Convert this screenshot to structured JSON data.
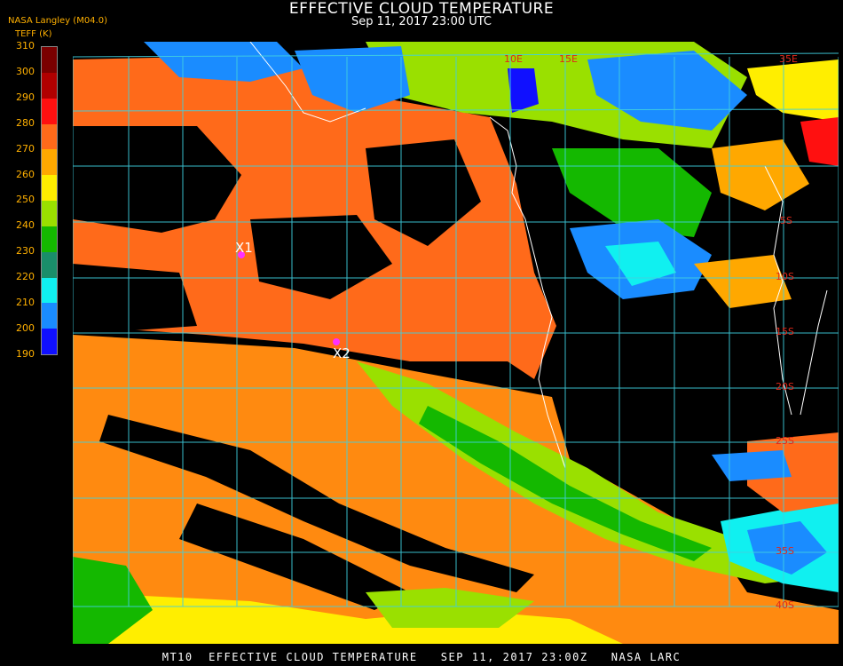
{
  "header": {
    "title": "EFFECTIVE CLOUD TEMPERATURE",
    "subtitle": "Sep 11, 2017 23:00 UTC",
    "source": "NASA Langley (M04.0)",
    "units": "TEFF (K)"
  },
  "colorbar": {
    "labels": [
      "310",
      "300",
      "290",
      "280",
      "270",
      "260",
      "250",
      "240",
      "230",
      "220",
      "210",
      "200",
      "190"
    ],
    "colors": [
      "#7a0000",
      "#b00000",
      "#ff1010",
      "#ff6a1a",
      "#ffa800",
      "#ffee00",
      "#9ae000",
      "#14b800",
      "#1a8e6a",
      "#10f0f0",
      "#1a8cff",
      "#1010ff",
      "#9030e0"
    ]
  },
  "map": {
    "longitude_labels": [
      "10E",
      "15E",
      "35E"
    ],
    "latitude_labels": [
      "5S",
      "10S",
      "15S",
      "20S",
      "25S",
      "35S",
      "40S"
    ],
    "markers": [
      {
        "label": "X1",
        "color": "#ff30ff"
      },
      {
        "label": "X2",
        "color": "#ff30ff"
      }
    ]
  },
  "footer": {
    "text": "MT10  EFFECTIVE CLOUD TEMPERATURE   SEP 11, 2017 23:00Z   NASA LARC"
  }
}
